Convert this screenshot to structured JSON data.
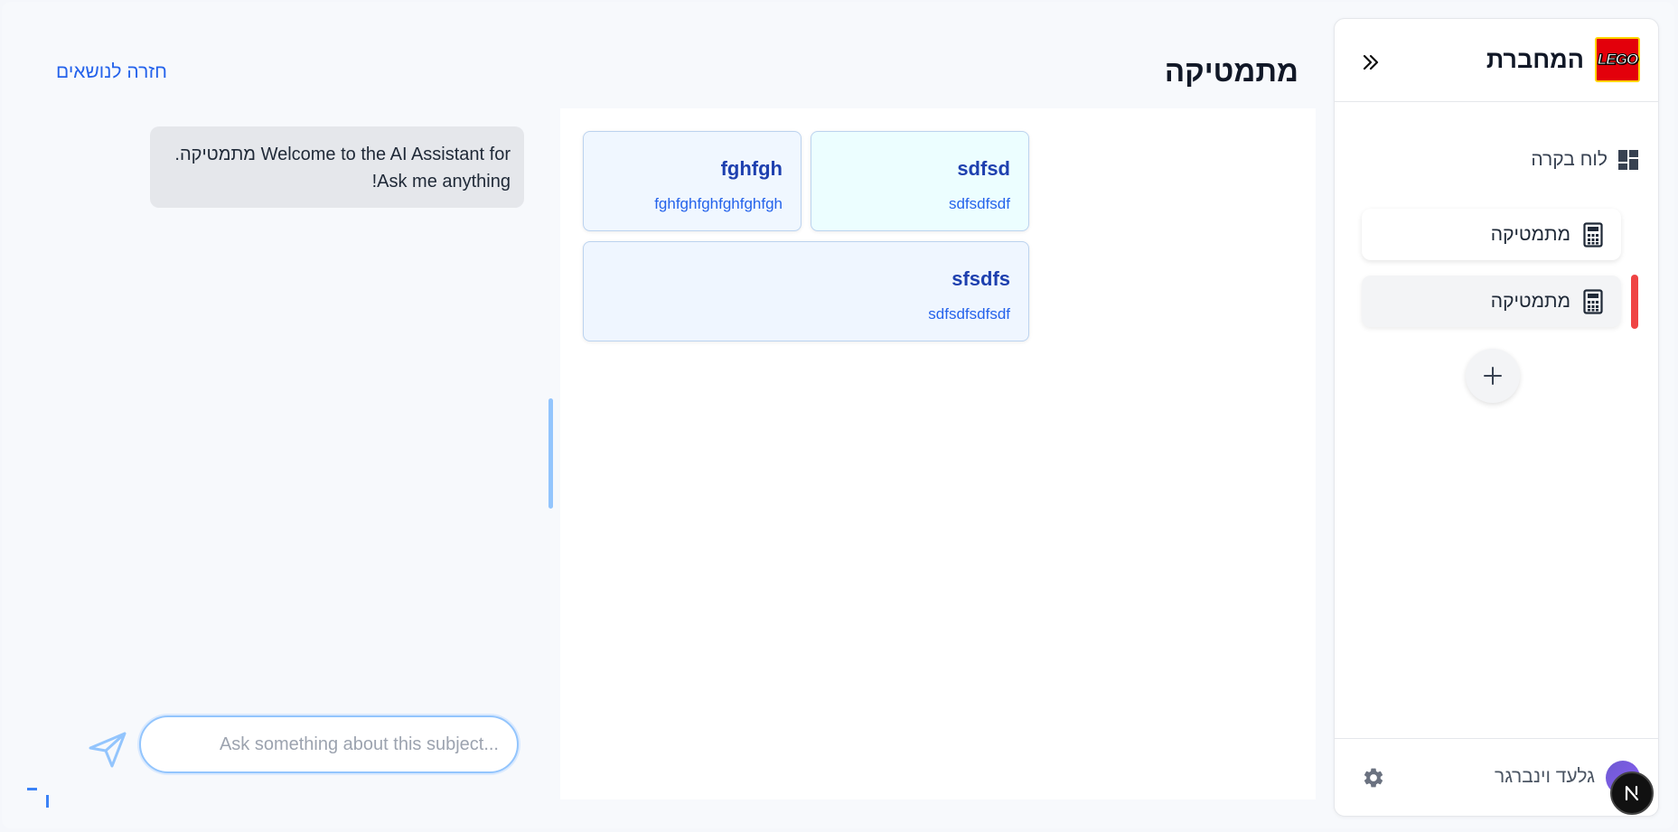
{
  "sidebar": {
    "brand": "המחברת",
    "logo_text": "LEGO",
    "dashboard_label": "לוח בקרה",
    "subjects": [
      {
        "label": "מתמטיקה",
        "icon": "calculator-icon"
      },
      {
        "label": "מתמטיקה",
        "icon": "calculator-icon",
        "active": true
      }
    ],
    "user_name": "גלעד וינברגר",
    "next_badge": "N"
  },
  "main": {
    "title": "מתמטיקה",
    "back_link": "חזרה לנושאים",
    "cards": [
      {
        "title": "sdfsd",
        "description": "sdfsdfsdf"
      },
      {
        "title": "fghfgh",
        "description": "fghfghfghfghfghfgh"
      },
      {
        "title": "sfsdfs",
        "description": "sdfsdfsdfsdf"
      }
    ]
  },
  "chat": {
    "welcome_message": "Welcome to the AI Assistant for מתמטיקה. Ask me anything!",
    "input_placeholder": "Ask something about this subject...",
    "input_value": ""
  },
  "colors": {
    "accent": "#2563eb",
    "active_indicator": "#ef4444",
    "card_title": "#1e40af"
  }
}
